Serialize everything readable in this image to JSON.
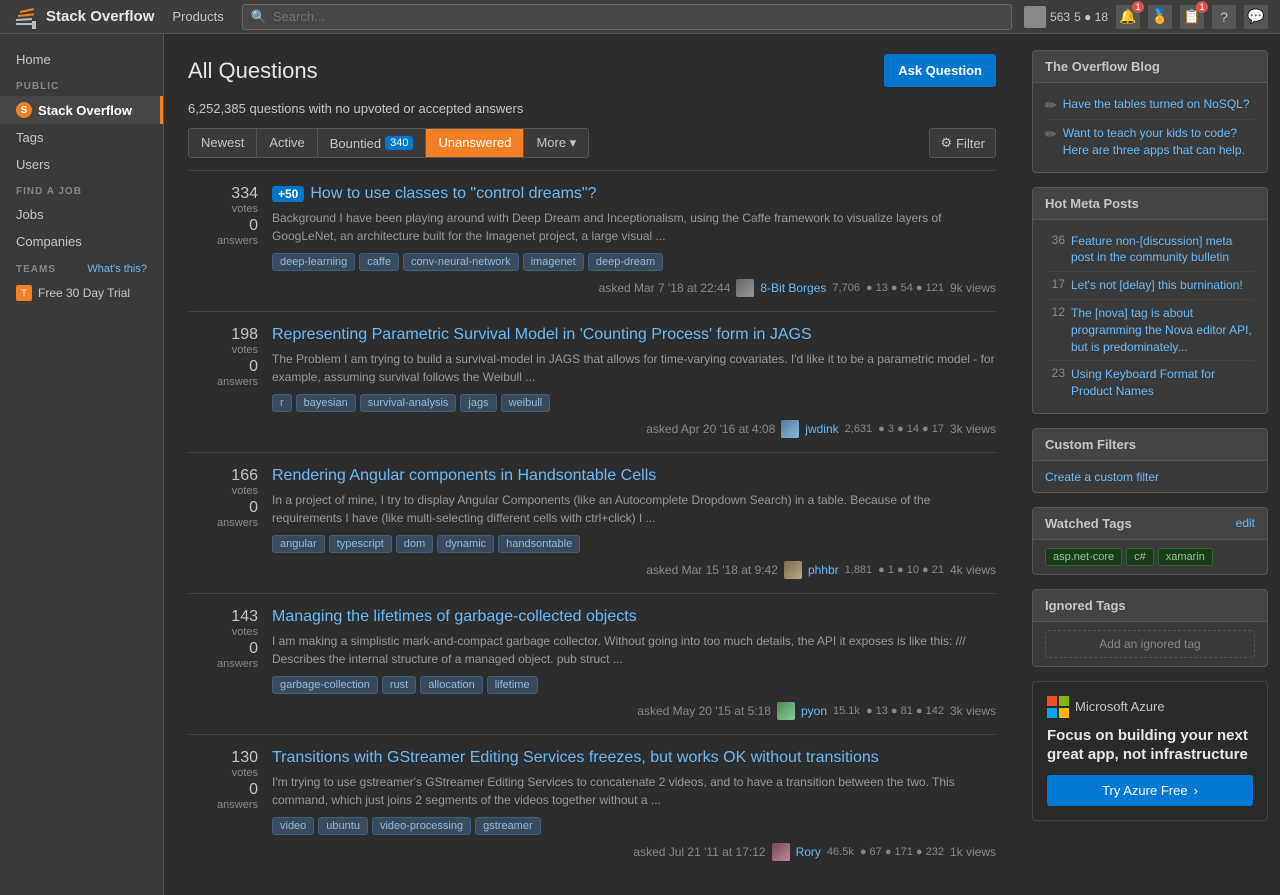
{
  "header": {
    "logo_text": "Stack Overflow",
    "nav_items": [
      "Products"
    ],
    "search_placeholder": "Search...",
    "user_score": "563",
    "user_badges": "5 ● 18"
  },
  "sidebar": {
    "public_label": "PUBLIC",
    "items": [
      {
        "id": "home",
        "label": "Home"
      },
      {
        "id": "stack-overflow",
        "label": "Stack Overflow",
        "active": true
      },
      {
        "id": "tags",
        "label": "Tags"
      },
      {
        "id": "users",
        "label": "Users"
      }
    ],
    "find_job_label": "FIND A JOB",
    "job_items": [
      {
        "id": "jobs",
        "label": "Jobs"
      },
      {
        "id": "companies",
        "label": "Companies"
      }
    ],
    "teams_label": "TEAMS",
    "teams_what": "What's this?",
    "teams_items": [
      {
        "id": "free-trial",
        "label": "Free 30 Day Trial"
      }
    ]
  },
  "main": {
    "page_title": "All Questions",
    "ask_button": "Ask Question",
    "questions_count": "6,252,385 questions with no upvoted or accepted answers",
    "filter_tabs": [
      {
        "id": "newest",
        "label": "Newest"
      },
      {
        "id": "active",
        "label": "Active"
      },
      {
        "id": "bountied",
        "label": "Bountied",
        "badge": "340"
      },
      {
        "id": "unanswered",
        "label": "Unanswered",
        "active": true
      },
      {
        "id": "more",
        "label": "More ▾"
      }
    ],
    "filter_button": "Filter",
    "questions": [
      {
        "id": "q1",
        "votes": "334",
        "answers": "0",
        "views": "9k views",
        "bounty": "+50",
        "title": "How to use classes to \"control dreams\"?",
        "excerpt": "Background I have been playing around with Deep Dream and Inceptionalism, using the Caffe framework to visualize layers of GoogLeNet, an architecture built for the Imagenet project, a large visual ...",
        "tags": [
          "deep-learning",
          "caffe",
          "conv-neural-network",
          "imagenet",
          "deep-dream"
        ],
        "asked": "asked Mar 7 '18 at 22:44",
        "user_name": "8-Bit Borges",
        "user_rep": "7,706",
        "user_badges": "● 13 ● 54 ● 121"
      },
      {
        "id": "q2",
        "votes": "198",
        "answers": "0",
        "views": "3k views",
        "bounty": "",
        "title": "Representing Parametric Survival Model in 'Counting Process' form in JAGS",
        "excerpt": "The Problem I am trying to build a survival-model in JAGS that allows for time-varying covariates. I'd like it to be a parametric model - for example, assuming survival follows the Weibull ...",
        "tags": [
          "r",
          "bayesian",
          "survival-analysis",
          "jags",
          "weibull"
        ],
        "asked": "asked Apr 20 '16 at 4:08",
        "user_name": "jwdink",
        "user_rep": "2,631",
        "user_badges": "● 3 ● 14 ● 17"
      },
      {
        "id": "q3",
        "votes": "166",
        "answers": "0",
        "views": "4k views",
        "bounty": "",
        "title": "Rendering Angular components in Handsontable Cells",
        "excerpt": "In a project of mine, I try to display Angular Components (like an Autocomplete Dropdown Search) in a table. Because of the requirements I have (like multi-selecting different cells with ctrl+click) I ...",
        "tags": [
          "angular",
          "typescript",
          "dom",
          "dynamic",
          "handsontable"
        ],
        "asked": "asked Mar 15 '18 at 9:42",
        "user_name": "phhbr",
        "user_rep": "1,881",
        "user_badges": "● 1 ● 10 ● 21"
      },
      {
        "id": "q4",
        "votes": "143",
        "answers": "0",
        "views": "3k views",
        "bounty": "",
        "title": "Managing the lifetimes of garbage-collected objects",
        "excerpt": "I am making a simplistic mark-and-compact garbage collector. Without going into too much details, the API it exposes is like this: /// Describes the internal structure of a managed object. pub struct ...",
        "tags": [
          "garbage-collection",
          "rust",
          "allocation",
          "lifetime"
        ],
        "asked": "asked May 20 '15 at 5:18",
        "user_name": "pyon",
        "user_rep": "15.1k",
        "user_badges": "● 13 ● 81 ● 142"
      },
      {
        "id": "q5",
        "votes": "130",
        "answers": "0",
        "views": "1k views",
        "bounty": "",
        "title": "Transitions with GStreamer Editing Services freezes, but works OK without transitions",
        "excerpt": "I'm trying to use gstreamer's GStreamer Editing Services to concatenate 2 videos, and to have a transition between the two. This command, which just joins 2 segments of the videos together without a ...",
        "tags": [
          "video",
          "ubuntu",
          "video-processing",
          "gstreamer"
        ],
        "asked": "asked Jul 21 '11 at 17:12",
        "user_name": "Rory",
        "user_rep": "46.5k",
        "user_badges": "● 67 ● 171 ● 232"
      }
    ]
  },
  "right_sidebar": {
    "blog": {
      "title": "The Overflow Blog",
      "items": [
        {
          "text": "Have the tables turned on NoSQL?"
        },
        {
          "text": "Want to teach your kids to code? Here are three apps that can help."
        }
      ]
    },
    "meta": {
      "title": "Hot Meta Posts",
      "items": [
        {
          "num": "36",
          "text": "Feature non-[discussion] meta post in the community bulletin"
        },
        {
          "num": "17",
          "text": "Let's not [delay] this burnination!"
        },
        {
          "num": "12",
          "text": "The [nova] tag is about programming the Nova editor API, but is predominately..."
        },
        {
          "num": "23",
          "text": "Using Keyboard Format for Product Names"
        }
      ]
    },
    "custom_filters": {
      "title": "Custom Filters",
      "create_link": "Create a custom filter"
    },
    "watched_tags": {
      "title": "Watched Tags",
      "edit": "edit",
      "tags": [
        "asp.net-core",
        "c#",
        "xamarin"
      ]
    },
    "ignored_tags": {
      "title": "Ignored Tags",
      "add_text": "Add an ignored tag"
    },
    "azure_ad": {
      "brand": "Microsoft Azure",
      "tagline": "Focus on building your next great app, not infrastructure",
      "button": "Try Azure Free"
    }
  }
}
